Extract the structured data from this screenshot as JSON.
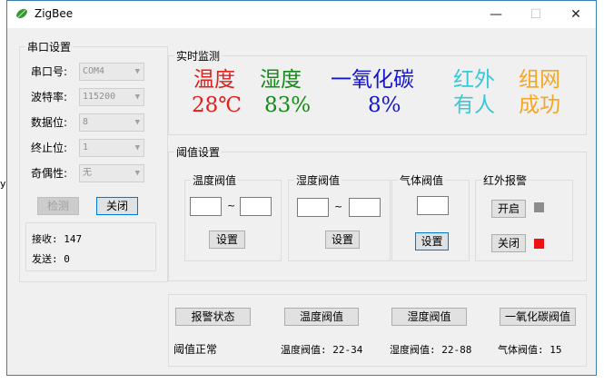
{
  "window": {
    "title": "ZigBee",
    "minimize_glyph": "—",
    "maximize_glyph": "☐",
    "close_glyph": "✕",
    "stray_text": "y!"
  },
  "serial": {
    "group_title": "串口设置",
    "rows": [
      {
        "label": "串口号:",
        "value": "COM4"
      },
      {
        "label": "波特率:",
        "value": "115200"
      },
      {
        "label": "数据位:",
        "value": "8"
      },
      {
        "label": "终止位:",
        "value": "1"
      },
      {
        "label": "奇偶性:",
        "value": "无"
      }
    ],
    "detect_label": "检测",
    "close_label": "关闭",
    "receive_text": "接收: 147",
    "send_text": "发送: 0"
  },
  "monitor": {
    "group_title": "实时监测",
    "items": [
      {
        "title": "温度",
        "value": "28℃",
        "color": "#e0201f"
      },
      {
        "title": "湿度",
        "value": "83%",
        "color": "#158a18"
      },
      {
        "title": "一氧化碳",
        "value": "8%",
        "color": "#1515cc"
      },
      {
        "title": "红外",
        "value": "有人",
        "color": "#3cc7d7"
      },
      {
        "title": "组网",
        "value": "成功",
        "color": "#f5a623"
      }
    ]
  },
  "threshold": {
    "group_title": "阈值设置",
    "temp": {
      "title": "温度阀值",
      "tilde": "~",
      "set_label": "设置"
    },
    "humidity": {
      "title": "湿度阀值",
      "tilde": "~",
      "set_label": "设置"
    },
    "gas": {
      "title": "气体阀值",
      "set_label": "设置"
    },
    "ir": {
      "title": "红外报警",
      "on_label": "开启",
      "off_label": "关闭",
      "on_indicator_color": "#8c8c8c",
      "off_indicator_color": "#ee1111"
    }
  },
  "status": {
    "buttons": [
      "报警状态",
      "温度阀值",
      "湿度阀值",
      "一氧化碳阀值"
    ],
    "texts": [
      "阈值正常",
      "温度阀值: 22-34",
      "湿度阀值: 22-88",
      "气体阀值: 15"
    ]
  }
}
